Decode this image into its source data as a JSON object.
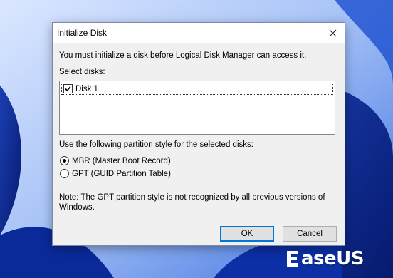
{
  "colors": {
    "wallpaper_dark": "#0b2a8c",
    "wallpaper_light": "#cfe0ff",
    "accent": "#0078d7"
  },
  "dialog": {
    "title": "Initialize Disk",
    "intro": "You must initialize a disk before Logical Disk Manager can access it.",
    "select_label": "Select disks:",
    "disks": [
      {
        "label": "Disk 1",
        "checked": true
      }
    ],
    "style_label": "Use the following partition style for the selected disks:",
    "options": [
      {
        "label": "MBR (Master Boot Record)",
        "selected": true
      },
      {
        "label": "GPT (GUID Partition Table)",
        "selected": false
      }
    ],
    "note": "Note: The GPT partition style is not recognized by all previous versions of Windows.",
    "ok_label": "OK",
    "cancel_label": "Cancel"
  },
  "watermark": {
    "brand": "EaseUS",
    "text": "aseUS"
  }
}
